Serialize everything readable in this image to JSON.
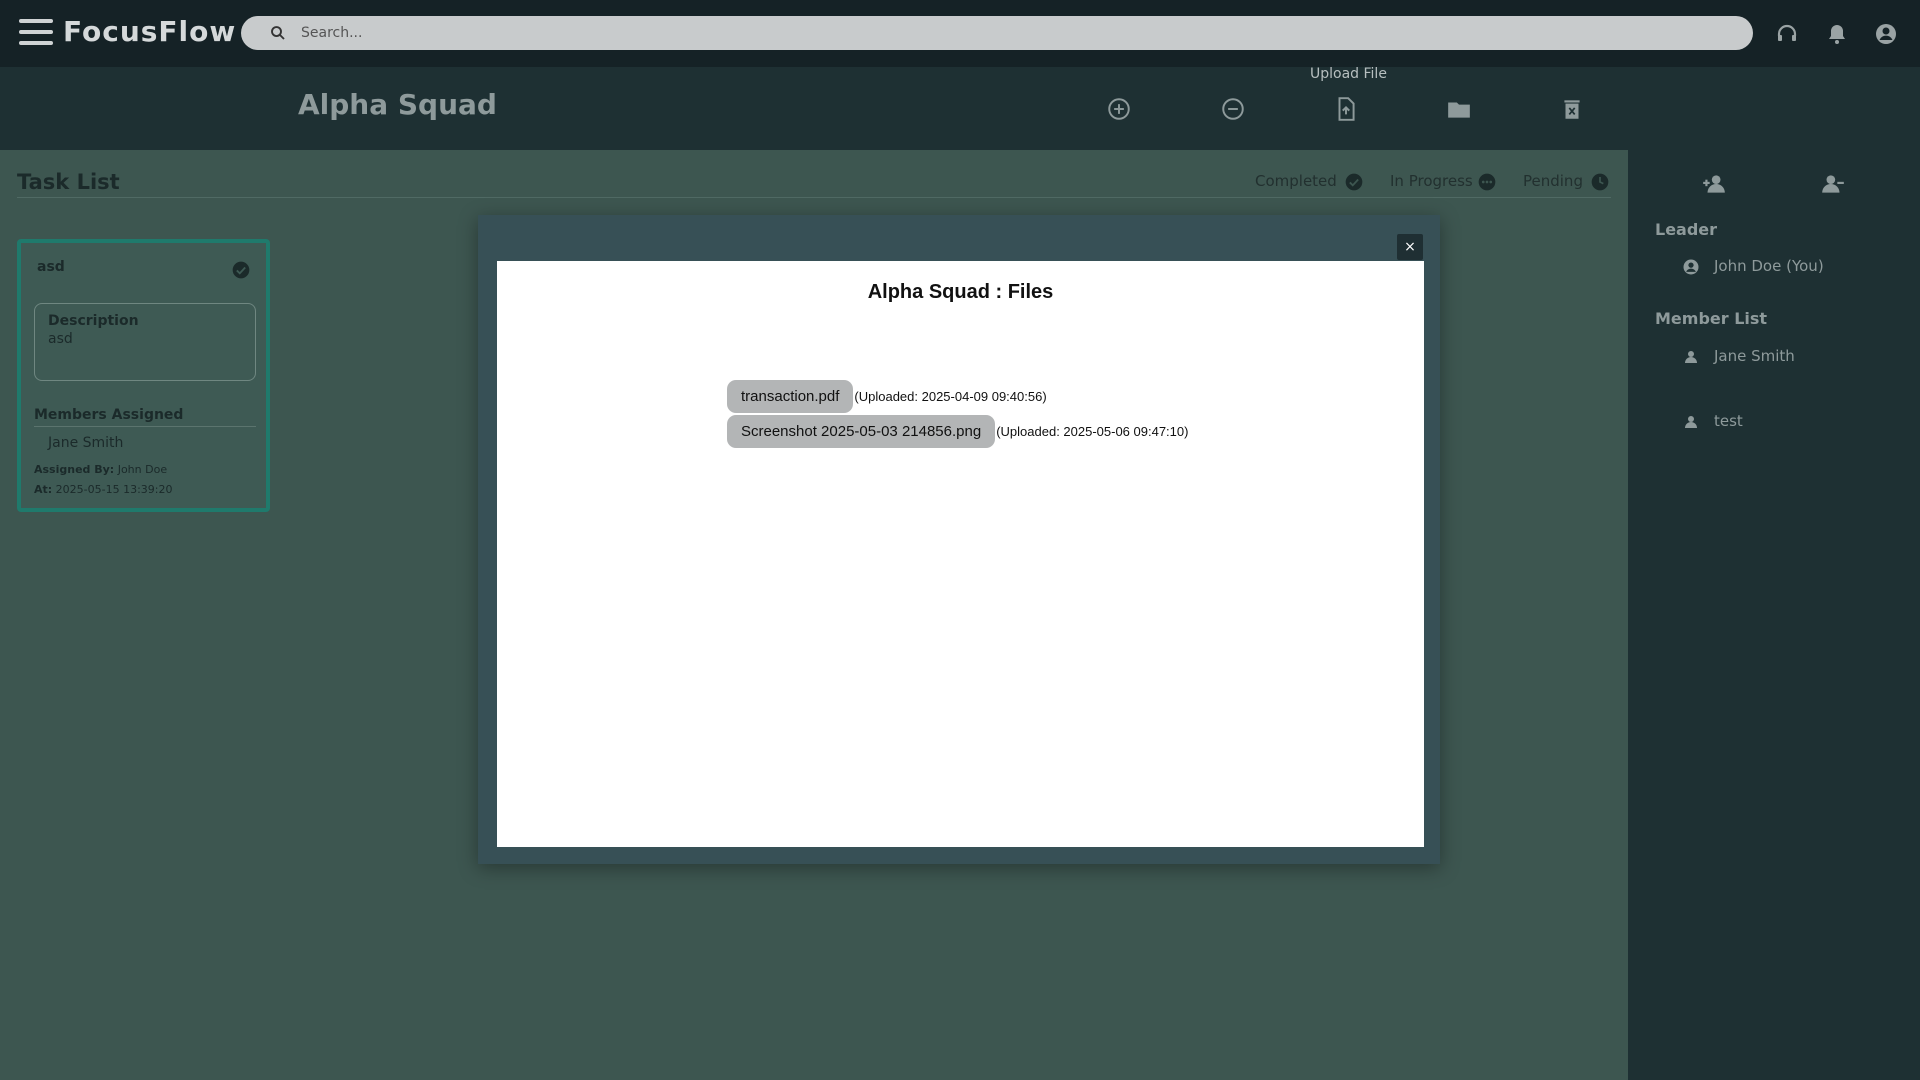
{
  "app": {
    "brand": "FocusFlow"
  },
  "search": {
    "placeholder": "Search..."
  },
  "header": {
    "team_name": "Alpha Squad",
    "upload_tooltip": "Upload File"
  },
  "tasks": {
    "title": "Task List",
    "statuses": [
      {
        "label": "Completed"
      },
      {
        "label": "In Progress"
      },
      {
        "label": "Pending"
      }
    ],
    "card": {
      "name": "asd",
      "description_label": "Description",
      "description": "asd",
      "members_label": "Members Assigned",
      "member": "Jane Smith",
      "assigned_by_label": "Assigned By:",
      "assigned_by": "John Doe",
      "at_label": "At:",
      "at": "2025-05-15 13:39:20"
    }
  },
  "sidebar": {
    "leader_heading": "Leader",
    "leader": "John Doe (You)",
    "members_heading": "Member List",
    "members": [
      "Jane Smith",
      "test"
    ]
  },
  "modal": {
    "close_label": "×",
    "title": "Alpha Squad : Files",
    "files": [
      {
        "name": "transaction.pdf",
        "uploaded": "(Uploaded: 2025-04-09 09:40:56)"
      },
      {
        "name": "Screenshot 2025-05-03 214856.png",
        "uploaded": "(Uploaded: 2025-05-06 09:47:10)"
      }
    ]
  },
  "colors": {
    "topbar": "#152226",
    "main": "#3d5650",
    "card_border": "#1f7a6c",
    "sidebar": "#1e3033"
  }
}
